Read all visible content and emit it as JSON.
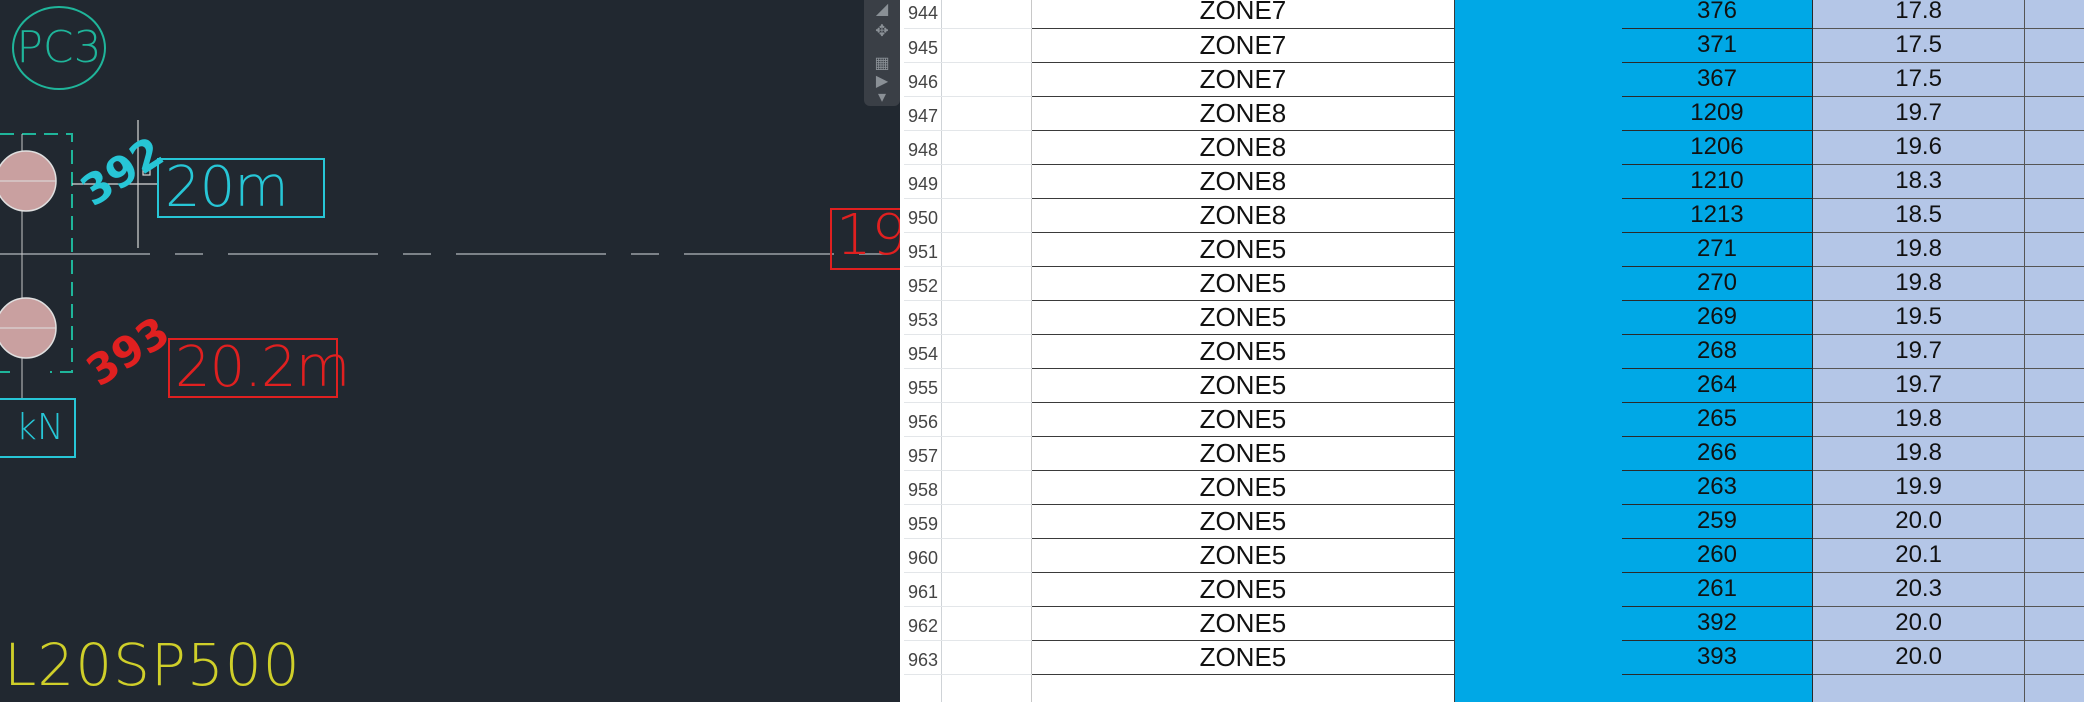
{
  "cad": {
    "pc3_label": "PC3",
    "pile_392_label": "392",
    "pile_393_label": "393",
    "cyan_box_label": "20m",
    "red_box_label": "20.2m",
    "red_partial_label": "19",
    "kn_label": "kN",
    "bottom_code": "L20SP500",
    "colors": {
      "background": "#212830",
      "cyan": "#27c6d6",
      "red": "#e02020",
      "green": "#1fb59a",
      "yellow": "#cfcf2a"
    }
  },
  "sheet": {
    "colors": {
      "blue_fill": "#00a8e6",
      "lavender_fill": "#b4c6e7"
    },
    "rows": [
      {
        "row": "944",
        "zone": "ZONE7",
        "id": "376",
        "value": "17.8"
      },
      {
        "row": "945",
        "zone": "ZONE7",
        "id": "371",
        "value": "17.5"
      },
      {
        "row": "946",
        "zone": "ZONE7",
        "id": "367",
        "value": "17.5"
      },
      {
        "row": "947",
        "zone": "ZONE8",
        "id": "1209",
        "value": "19.7"
      },
      {
        "row": "948",
        "zone": "ZONE8",
        "id": "1206",
        "value": "19.6"
      },
      {
        "row": "949",
        "zone": "ZONE8",
        "id": "1210",
        "value": "18.3"
      },
      {
        "row": "950",
        "zone": "ZONE8",
        "id": "1213",
        "value": "18.5"
      },
      {
        "row": "951",
        "zone": "ZONE5",
        "id": "271",
        "value": "19.8"
      },
      {
        "row": "952",
        "zone": "ZONE5",
        "id": "270",
        "value": "19.8"
      },
      {
        "row": "953",
        "zone": "ZONE5",
        "id": "269",
        "value": "19.5"
      },
      {
        "row": "954",
        "zone": "ZONE5",
        "id": "268",
        "value": "19.7"
      },
      {
        "row": "955",
        "zone": "ZONE5",
        "id": "264",
        "value": "19.7"
      },
      {
        "row": "956",
        "zone": "ZONE5",
        "id": "265",
        "value": "19.8"
      },
      {
        "row": "957",
        "zone": "ZONE5",
        "id": "266",
        "value": "19.8"
      },
      {
        "row": "958",
        "zone": "ZONE5",
        "id": "263",
        "value": "19.9"
      },
      {
        "row": "959",
        "zone": "ZONE5",
        "id": "259",
        "value": "20.0"
      },
      {
        "row": "960",
        "zone": "ZONE5",
        "id": "260",
        "value": "20.1"
      },
      {
        "row": "961",
        "zone": "ZONE5",
        "id": "261",
        "value": "20.3"
      },
      {
        "row": "962",
        "zone": "ZONE5",
        "id": "392",
        "value": "20.0"
      },
      {
        "row": "963",
        "zone": "ZONE5",
        "id": "393",
        "value": "20.0"
      },
      {
        "row": "",
        "zone": "",
        "id": "",
        "value": ""
      }
    ]
  }
}
